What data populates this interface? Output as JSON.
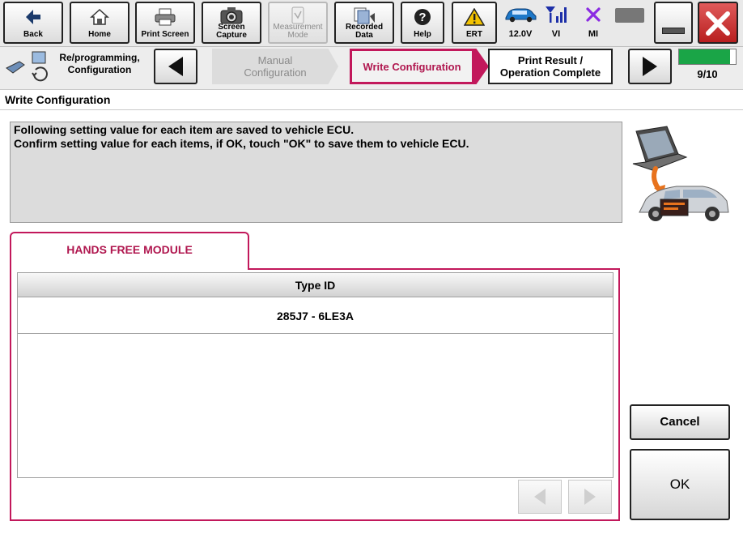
{
  "toolbar": {
    "back_label": "Back",
    "home_label": "Home",
    "print_label": "Print Screen",
    "capture_label_1": "Screen",
    "capture_label_2": "Capture",
    "measure_label_1": "Measurement",
    "measure_label_2": "Mode",
    "recorded_label_1": "Recorded",
    "recorded_label_2": "Data",
    "help_label": "Help",
    "ert_label": "ERT",
    "battery_label": "12.0V",
    "vi_label": "VI",
    "mi_label": "MI"
  },
  "nav": {
    "reprog_line1": "Re/programming,",
    "reprog_line2": "Configuration",
    "step_prev_line1": "Manual",
    "step_prev_line2": "Configuration",
    "step_current": "Write Configuration",
    "step_next_line1": "Print Result /",
    "step_next_line2": "Operation Complete",
    "progress_text": "9/10",
    "progress_fraction": 0.9
  },
  "title": "Write Configuration",
  "instructions": {
    "line1": "Following setting value for each item are saved to vehicle ECU.",
    "line2": "Confirm setting value for each items, if OK, touch \"OK\" to save them to vehicle ECU."
  },
  "tab_label": "HANDS FREE MODULE",
  "table": {
    "header": "Type ID",
    "rows": [
      "285J7 - 6LE3A"
    ]
  },
  "buttons": {
    "cancel": "Cancel",
    "ok": "OK"
  },
  "colors": {
    "accent": "#c2185b",
    "progress": "#1aa547",
    "vi_icon": "#1d2fa8",
    "mi_icon": "#8a2be2",
    "ert_icon": "#f2c200",
    "close_button": "#d33a3a"
  }
}
